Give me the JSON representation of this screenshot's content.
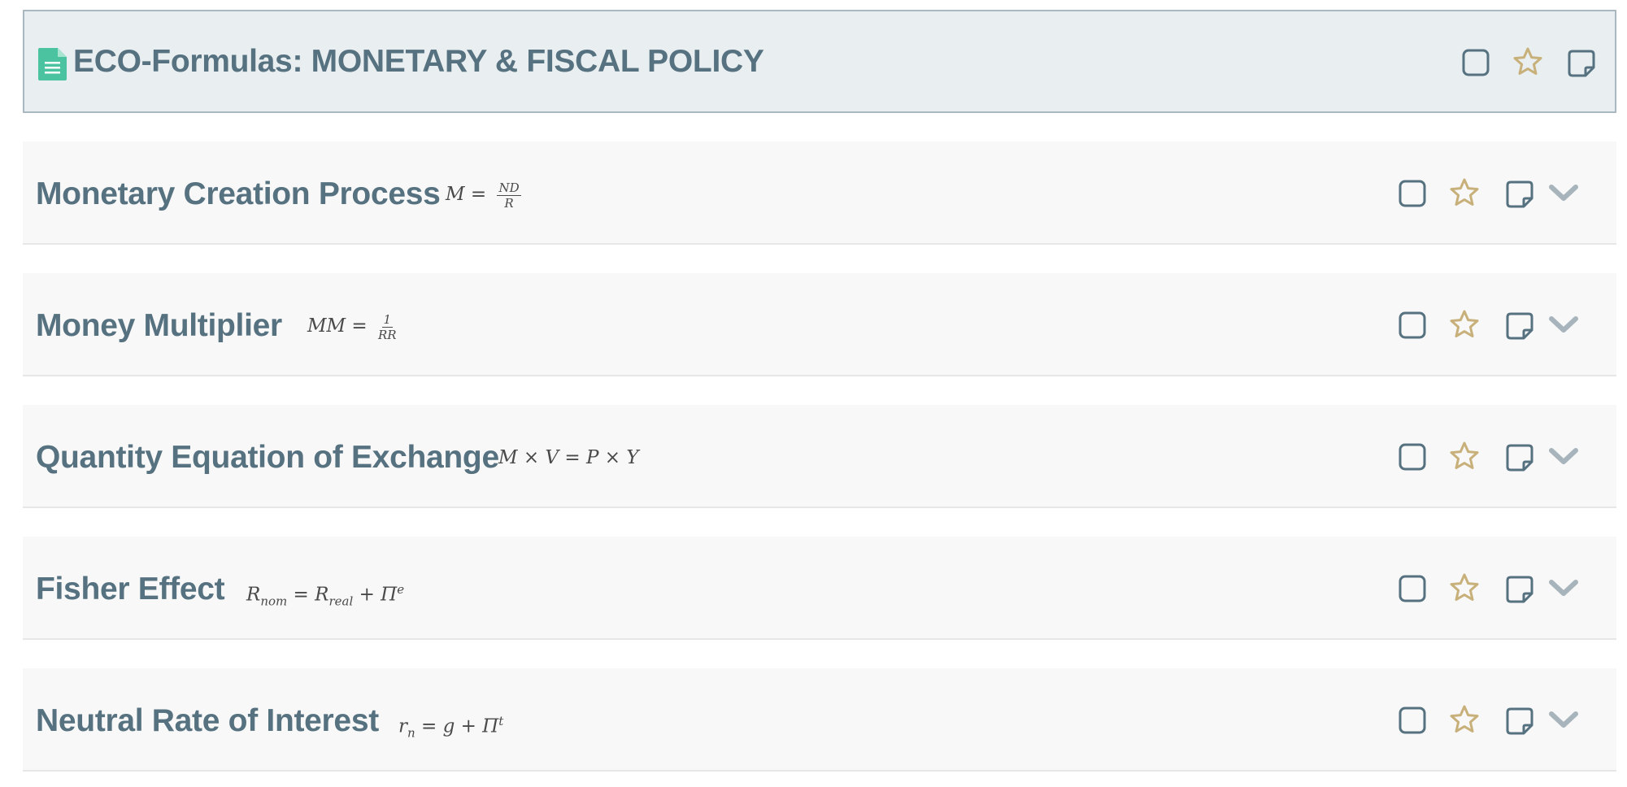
{
  "header": {
    "title": "ECO-Formulas: MONETARY & FISCAL POLICY",
    "icons": [
      "document-icon",
      "checkbox-icon",
      "star-icon",
      "note-icon"
    ]
  },
  "colors": {
    "title": "#56717f",
    "icon_slate": "#56717f",
    "star_gold": "#c8b07a",
    "chevron": "#a8b4bc",
    "doc_green": "#4cc3a0",
    "header_bg": "#e9eef0",
    "row_bg": "#f8f8f8"
  },
  "rows": [
    {
      "title": "Monetary Creation Process",
      "formula": {
        "lhs": "M = ",
        "num": "ND",
        "den": "R"
      }
    },
    {
      "title": "Money Multiplier",
      "formula": {
        "lhs": "MM = ",
        "num": "1",
        "den": "RR"
      }
    },
    {
      "title": "Quantity Equation of Exchange",
      "formula": {
        "text": "M × V = P × Y"
      }
    },
    {
      "title": "Fisher Effect",
      "formula": {
        "p1": "R",
        "s1": "nom",
        "p2": " = R",
        "s2": "real",
        "p3": " + Π",
        "sup": "e"
      }
    },
    {
      "title": "Neutral Rate of Interest",
      "formula": {
        "p1": "r",
        "s1": "n",
        "p2": " = g + Π",
        "sup": "t"
      }
    }
  ]
}
